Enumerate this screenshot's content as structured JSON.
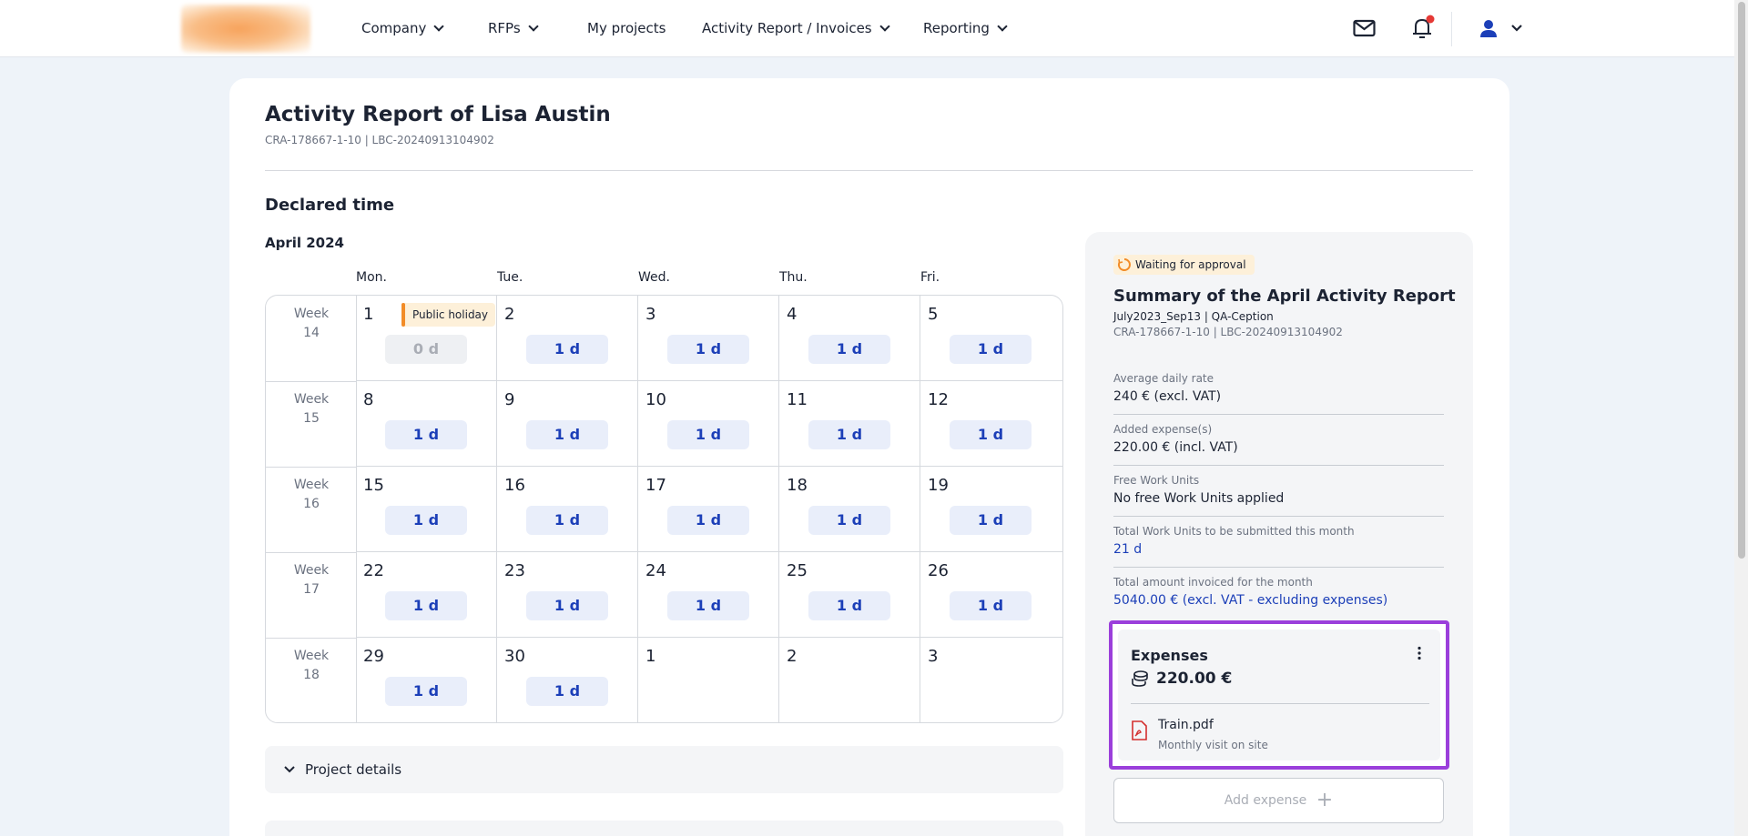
{
  "nav": {
    "items": [
      {
        "label": "Company",
        "dropdown": true
      },
      {
        "label": "RFPs",
        "dropdown": true
      },
      {
        "label": "My projects",
        "dropdown": false
      },
      {
        "label": "Activity Report / Invoices",
        "dropdown": true
      },
      {
        "label": "Reporting",
        "dropdown": true
      }
    ],
    "icons": [
      "mail-icon",
      "bell-icon",
      "user-icon"
    ],
    "notification_dot_color": "#e53935"
  },
  "page": {
    "title": "Activity Report of Lisa Austin",
    "subtitle": "CRA-178667-1-10 | LBC-20240913104902"
  },
  "declared": {
    "section_title": "Declared time",
    "month": "April 2024",
    "day_headers": [
      "Mon.",
      "Tue.",
      "Wed.",
      "Thu.",
      "Fri."
    ],
    "weeks": [
      {
        "week": "Week",
        "number": "14",
        "days": [
          {
            "n": "1",
            "value": "0 d",
            "zero": true,
            "holiday": "Public holiday"
          },
          {
            "n": "2",
            "value": "1 d"
          },
          {
            "n": "3",
            "value": "1 d"
          },
          {
            "n": "4",
            "value": "1 d"
          },
          {
            "n": "5",
            "value": "1 d"
          }
        ]
      },
      {
        "week": "Week",
        "number": "15",
        "days": [
          {
            "n": "8",
            "value": "1 d"
          },
          {
            "n": "9",
            "value": "1 d"
          },
          {
            "n": "10",
            "value": "1 d"
          },
          {
            "n": "11",
            "value": "1 d"
          },
          {
            "n": "12",
            "value": "1 d"
          }
        ]
      },
      {
        "week": "Week",
        "number": "16",
        "days": [
          {
            "n": "15",
            "value": "1 d"
          },
          {
            "n": "16",
            "value": "1 d"
          },
          {
            "n": "17",
            "value": "1 d"
          },
          {
            "n": "18",
            "value": "1 d"
          },
          {
            "n": "19",
            "value": "1 d"
          }
        ]
      },
      {
        "week": "Week",
        "number": "17",
        "days": [
          {
            "n": "22",
            "value": "1 d"
          },
          {
            "n": "23",
            "value": "1 d"
          },
          {
            "n": "24",
            "value": "1 d"
          },
          {
            "n": "25",
            "value": "1 d"
          },
          {
            "n": "26",
            "value": "1 d"
          }
        ]
      },
      {
        "week": "Week",
        "number": "18",
        "days": [
          {
            "n": "29",
            "value": "1 d"
          },
          {
            "n": "30",
            "value": "1 d"
          },
          {
            "n": "1",
            "value": null
          },
          {
            "n": "2",
            "value": null
          },
          {
            "n": "3",
            "value": null
          }
        ]
      }
    ],
    "collapsibles": [
      "Project details"
    ]
  },
  "summary": {
    "status": "Waiting for approval",
    "title": "Summary of the April Activity Report",
    "line1": "July2023_Sep13 | QA-Ception",
    "line2": "CRA-178667-1-10 | LBC-20240913104902",
    "fields": [
      {
        "label": "Average daily rate",
        "value": "240 € (excl. VAT)",
        "blue": false
      },
      {
        "label": "Added expense(s)",
        "value": "220.00 € (incl. VAT)",
        "blue": false
      },
      {
        "label": "Free Work Units",
        "value": "No free Work Units applied",
        "blue": false
      },
      {
        "label": "Total Work Units to be submitted this month",
        "value": "21 d",
        "blue": true
      },
      {
        "label": "Total amount invoiced for the month",
        "value": "5040.00 € (excl. VAT - excluding expenses)",
        "blue": true
      }
    ],
    "expenses": {
      "title": "Expenses",
      "amount": "220.00 €",
      "file": "Train.pdf",
      "description": "Monthly visit on site"
    },
    "add_expense_label": "Add expense"
  },
  "colors": {
    "accent_blue": "#1c3fb8",
    "highlight_purple": "#9b3fdb",
    "holiday_orange": "#f28c28"
  }
}
